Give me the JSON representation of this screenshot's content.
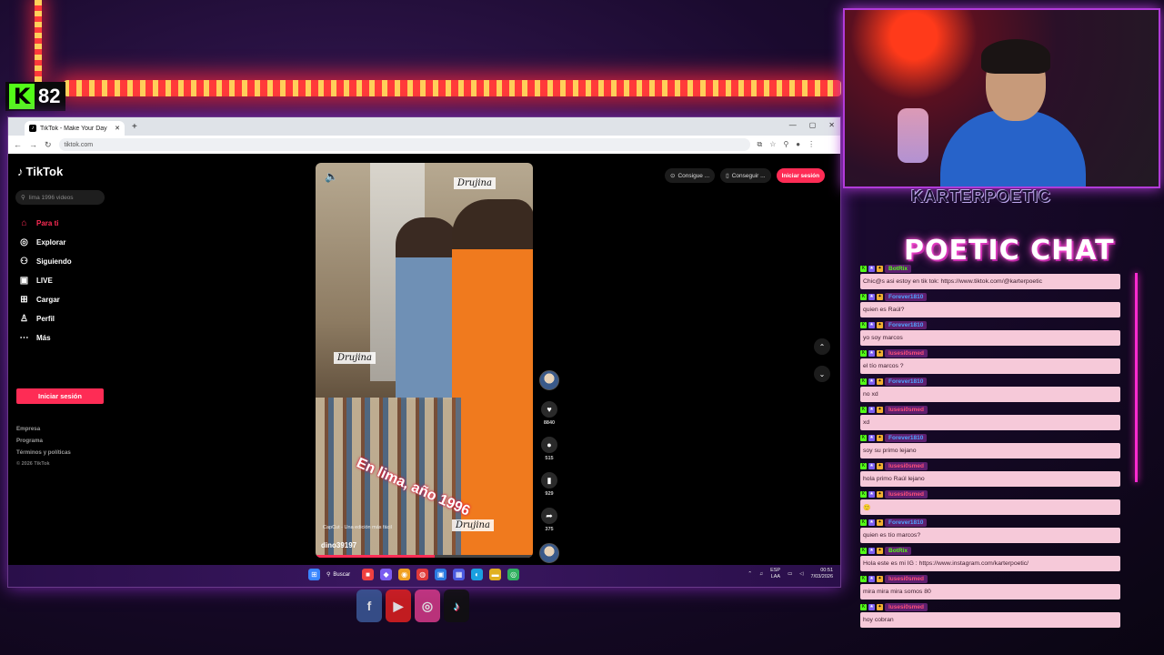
{
  "kick": {
    "logo": "K",
    "viewers": "82"
  },
  "browser": {
    "tab_title": "TikTok - Make Your Day",
    "new_tab": "+",
    "address": "tiktok.com",
    "win_min": "—",
    "win_max": "▢",
    "win_close": "✕"
  },
  "tiktok": {
    "logo": "TikTok",
    "search_placeholder": "lima 1996 videos",
    "nav": [
      {
        "label": "Para ti",
        "icon": "home-icon",
        "glyph": "⌂"
      },
      {
        "label": "Explorar",
        "icon": "compass-icon",
        "glyph": "◎"
      },
      {
        "label": "Siguiendo",
        "icon": "following-icon",
        "glyph": "⚇"
      },
      {
        "label": "LIVE",
        "icon": "live-icon",
        "glyph": "▣"
      },
      {
        "label": "Cargar",
        "icon": "upload-icon",
        "glyph": "⊞"
      },
      {
        "label": "Perfil",
        "icon": "profile-icon",
        "glyph": "♙"
      },
      {
        "label": "Más",
        "icon": "more-icon",
        "glyph": "⋯"
      }
    ],
    "login_label": "Iniciar sesión",
    "footer": [
      "Empresa",
      "Programa",
      "Términos y políticas"
    ],
    "copyright": "© 2026 TikTok",
    "top_buttons": [
      "Consigue ...",
      "Conseguir ..."
    ],
    "top_login": "Iniciar sesión"
  },
  "video": {
    "overlay_text": "En lima, año 1996",
    "watermark": "Drujina",
    "capcut": "CapCut - Una edición más fácil",
    "username": "dino39197",
    "progress": 0.55,
    "likes": "8840",
    "comments": "515",
    "saves": "929",
    "shares": "375"
  },
  "taskbar": {
    "search": "Buscar",
    "lang1": "ESP",
    "lang2": "LAA",
    "time": "00:51",
    "date": "7/03/2026"
  },
  "stream": {
    "name": "KARTERPOETIC",
    "chat_title": "POETIC CHAT",
    "messages": [
      {
        "user": "BotRix",
        "text": "Chic@s asi estoy en tik tok: https://www.tiktok.com/@karterpoetic"
      },
      {
        "user": "Forever1810",
        "text": "quien es Raúl?"
      },
      {
        "user": "Forever1810",
        "text": "yo soy marcos"
      },
      {
        "user": "lusesi0smed",
        "text": "el tío marcos ?"
      },
      {
        "user": "Forever1810",
        "text": "no xd"
      },
      {
        "user": "lusesi0smed",
        "text": "xd"
      },
      {
        "user": "Forever1810",
        "text": "soy su primo lejano"
      },
      {
        "user": "lusesi0smed",
        "text": "hola primo Raúl lejano"
      },
      {
        "user": "lusesi0smed",
        "text": "🙂"
      },
      {
        "user": "Forever1810",
        "text": "quien es tío marcos?"
      },
      {
        "user": "BotRix",
        "text": "Hola este es mi IG : https://www.instagram.com/karterpoetic/"
      },
      {
        "user": "lusesi0smed",
        "text": "mira mira mira somos 80"
      },
      {
        "user": "lusesi0smed",
        "text": "hoy cobran"
      }
    ]
  },
  "social": [
    "f",
    "▶",
    "◎",
    "♪"
  ]
}
